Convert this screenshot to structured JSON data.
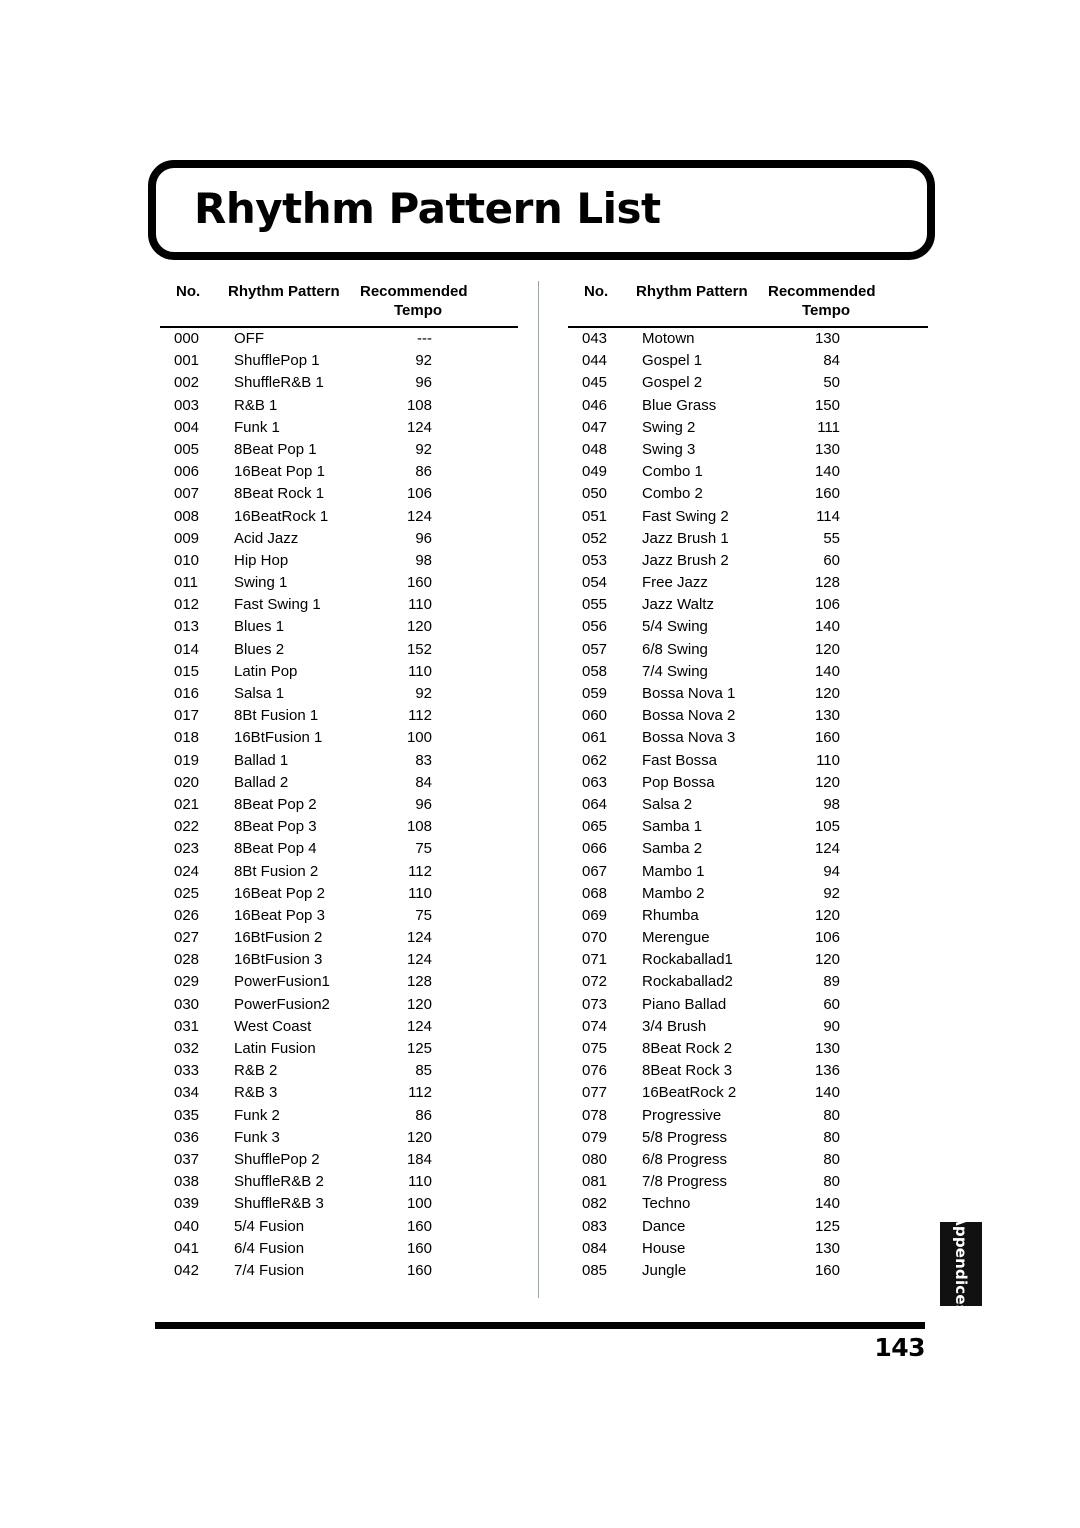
{
  "page": {
    "title": "Rhythm Pattern List",
    "page_number": "143",
    "section_tab": "Appendices"
  },
  "table": {
    "headers": {
      "no": "No.",
      "pattern": "Rhythm Pattern",
      "tempo_line1": "Recommended",
      "tempo_line2": "Tempo"
    },
    "columns": [
      {
        "rows": [
          {
            "no": "000",
            "pattern": "OFF",
            "tempo": "---"
          },
          {
            "no": "001",
            "pattern": "ShufflePop 1",
            "tempo": "92"
          },
          {
            "no": "002",
            "pattern": "ShuffleR&B 1",
            "tempo": "96"
          },
          {
            "no": "003",
            "pattern": "R&B 1",
            "tempo": "108"
          },
          {
            "no": "004",
            "pattern": "Funk 1",
            "tempo": "124"
          },
          {
            "no": "005",
            "pattern": "8Beat Pop 1",
            "tempo": "92"
          },
          {
            "no": "006",
            "pattern": "16Beat Pop 1",
            "tempo": "86"
          },
          {
            "no": "007",
            "pattern": "8Beat Rock 1",
            "tempo": "106"
          },
          {
            "no": "008",
            "pattern": "16BeatRock 1",
            "tempo": "124"
          },
          {
            "no": "009",
            "pattern": "Acid Jazz",
            "tempo": "96"
          },
          {
            "no": "010",
            "pattern": "Hip Hop",
            "tempo": "98"
          },
          {
            "no": "011",
            "pattern": "Swing 1",
            "tempo": "160"
          },
          {
            "no": "012",
            "pattern": "Fast Swing 1",
            "tempo": "110"
          },
          {
            "no": "013",
            "pattern": "Blues 1",
            "tempo": "120"
          },
          {
            "no": "014",
            "pattern": "Blues 2",
            "tempo": "152"
          },
          {
            "no": "015",
            "pattern": "Latin Pop",
            "tempo": "110"
          },
          {
            "no": "016",
            "pattern": "Salsa 1",
            "tempo": "92"
          },
          {
            "no": "017",
            "pattern": "8Bt Fusion 1",
            "tempo": "112"
          },
          {
            "no": "018",
            "pattern": "16BtFusion 1",
            "tempo": "100"
          },
          {
            "no": "019",
            "pattern": "Ballad 1",
            "tempo": "83"
          },
          {
            "no": "020",
            "pattern": "Ballad 2",
            "tempo": "84"
          },
          {
            "no": "021",
            "pattern": "8Beat Pop 2",
            "tempo": "96"
          },
          {
            "no": "022",
            "pattern": "8Beat Pop 3",
            "tempo": "108"
          },
          {
            "no": "023",
            "pattern": "8Beat Pop 4",
            "tempo": "75"
          },
          {
            "no": "024",
            "pattern": "8Bt Fusion 2",
            "tempo": "112"
          },
          {
            "no": "025",
            "pattern": "16Beat Pop 2",
            "tempo": "110"
          },
          {
            "no": "026",
            "pattern": "16Beat Pop 3",
            "tempo": "75"
          },
          {
            "no": "027",
            "pattern": "16BtFusion 2",
            "tempo": "124"
          },
          {
            "no": "028",
            "pattern": "16BtFusion 3",
            "tempo": "124"
          },
          {
            "no": "029",
            "pattern": "PowerFusion1",
            "tempo": "128"
          },
          {
            "no": "030",
            "pattern": "PowerFusion2",
            "tempo": "120"
          },
          {
            "no": "031",
            "pattern": "West Coast",
            "tempo": "124"
          },
          {
            "no": "032",
            "pattern": "Latin Fusion",
            "tempo": "125"
          },
          {
            "no": "033",
            "pattern": "R&B 2",
            "tempo": "85"
          },
          {
            "no": "034",
            "pattern": "R&B 3",
            "tempo": "112"
          },
          {
            "no": "035",
            "pattern": "Funk 2",
            "tempo": "86"
          },
          {
            "no": "036",
            "pattern": "Funk 3",
            "tempo": "120"
          },
          {
            "no": "037",
            "pattern": "ShufflePop 2",
            "tempo": "184"
          },
          {
            "no": "038",
            "pattern": "ShuffleR&B 2",
            "tempo": "110"
          },
          {
            "no": "039",
            "pattern": "ShuffleR&B 3",
            "tempo": "100"
          },
          {
            "no": "040",
            "pattern": "5/4 Fusion",
            "tempo": "160"
          },
          {
            "no": "041",
            "pattern": "6/4 Fusion",
            "tempo": "160"
          },
          {
            "no": "042",
            "pattern": "7/4 Fusion",
            "tempo": "160"
          }
        ]
      },
      {
        "rows": [
          {
            "no": "043",
            "pattern": "Motown",
            "tempo": "130"
          },
          {
            "no": "044",
            "pattern": "Gospel 1",
            "tempo": "84"
          },
          {
            "no": "045",
            "pattern": "Gospel 2",
            "tempo": "50"
          },
          {
            "no": "046",
            "pattern": "Blue Grass",
            "tempo": "150"
          },
          {
            "no": "047",
            "pattern": "Swing 2",
            "tempo": "111"
          },
          {
            "no": "048",
            "pattern": "Swing 3",
            "tempo": "130"
          },
          {
            "no": "049",
            "pattern": "Combo 1",
            "tempo": "140"
          },
          {
            "no": "050",
            "pattern": "Combo 2",
            "tempo": "160"
          },
          {
            "no": "051",
            "pattern": "Fast Swing 2",
            "tempo": "114"
          },
          {
            "no": "052",
            "pattern": "Jazz Brush 1",
            "tempo": "55"
          },
          {
            "no": "053",
            "pattern": "Jazz Brush 2",
            "tempo": "60"
          },
          {
            "no": "054",
            "pattern": "Free Jazz",
            "tempo": "128"
          },
          {
            "no": "055",
            "pattern": "Jazz Waltz",
            "tempo": "106"
          },
          {
            "no": "056",
            "pattern": "5/4 Swing",
            "tempo": "140"
          },
          {
            "no": "057",
            "pattern": "6/8 Swing",
            "tempo": "120"
          },
          {
            "no": "058",
            "pattern": "7/4 Swing",
            "tempo": "140"
          },
          {
            "no": "059",
            "pattern": "Bossa Nova 1",
            "tempo": "120"
          },
          {
            "no": "060",
            "pattern": "Bossa Nova 2",
            "tempo": "130"
          },
          {
            "no": "061",
            "pattern": "Bossa Nova 3",
            "tempo": "160"
          },
          {
            "no": "062",
            "pattern": "Fast Bossa",
            "tempo": "110"
          },
          {
            "no": "063",
            "pattern": "Pop Bossa",
            "tempo": "120"
          },
          {
            "no": "064",
            "pattern": "Salsa 2",
            "tempo": "98"
          },
          {
            "no": "065",
            "pattern": "Samba 1",
            "tempo": "105"
          },
          {
            "no": "066",
            "pattern": "Samba 2",
            "tempo": "124"
          },
          {
            "no": "067",
            "pattern": "Mambo 1",
            "tempo": "94"
          },
          {
            "no": "068",
            "pattern": "Mambo 2",
            "tempo": "92"
          },
          {
            "no": "069",
            "pattern": "Rhumba",
            "tempo": "120"
          },
          {
            "no": "070",
            "pattern": "Merengue",
            "tempo": "106"
          },
          {
            "no": "071",
            "pattern": "Rockaballad1",
            "tempo": "120"
          },
          {
            "no": "072",
            "pattern": "Rockaballad2",
            "tempo": "89"
          },
          {
            "no": "073",
            "pattern": "Piano Ballad",
            "tempo": "60"
          },
          {
            "no": "074",
            "pattern": "3/4 Brush",
            "tempo": "90"
          },
          {
            "no": "075",
            "pattern": "8Beat Rock 2",
            "tempo": "130"
          },
          {
            "no": "076",
            "pattern": "8Beat Rock 3",
            "tempo": "136"
          },
          {
            "no": "077",
            "pattern": "16BeatRock 2",
            "tempo": "140"
          },
          {
            "no": "078",
            "pattern": "Progressive",
            "tempo": "80"
          },
          {
            "no": "079",
            "pattern": "5/8 Progress",
            "tempo": "80"
          },
          {
            "no": "080",
            "pattern": "6/8 Progress",
            "tempo": "80"
          },
          {
            "no": "081",
            "pattern": "7/8 Progress",
            "tempo": "80"
          },
          {
            "no": "082",
            "pattern": "Techno",
            "tempo": "140"
          },
          {
            "no": "083",
            "pattern": "Dance",
            "tempo": "125"
          },
          {
            "no": "084",
            "pattern": "House",
            "tempo": "130"
          },
          {
            "no": "085",
            "pattern": "Jungle",
            "tempo": "160"
          }
        ]
      }
    ]
  }
}
